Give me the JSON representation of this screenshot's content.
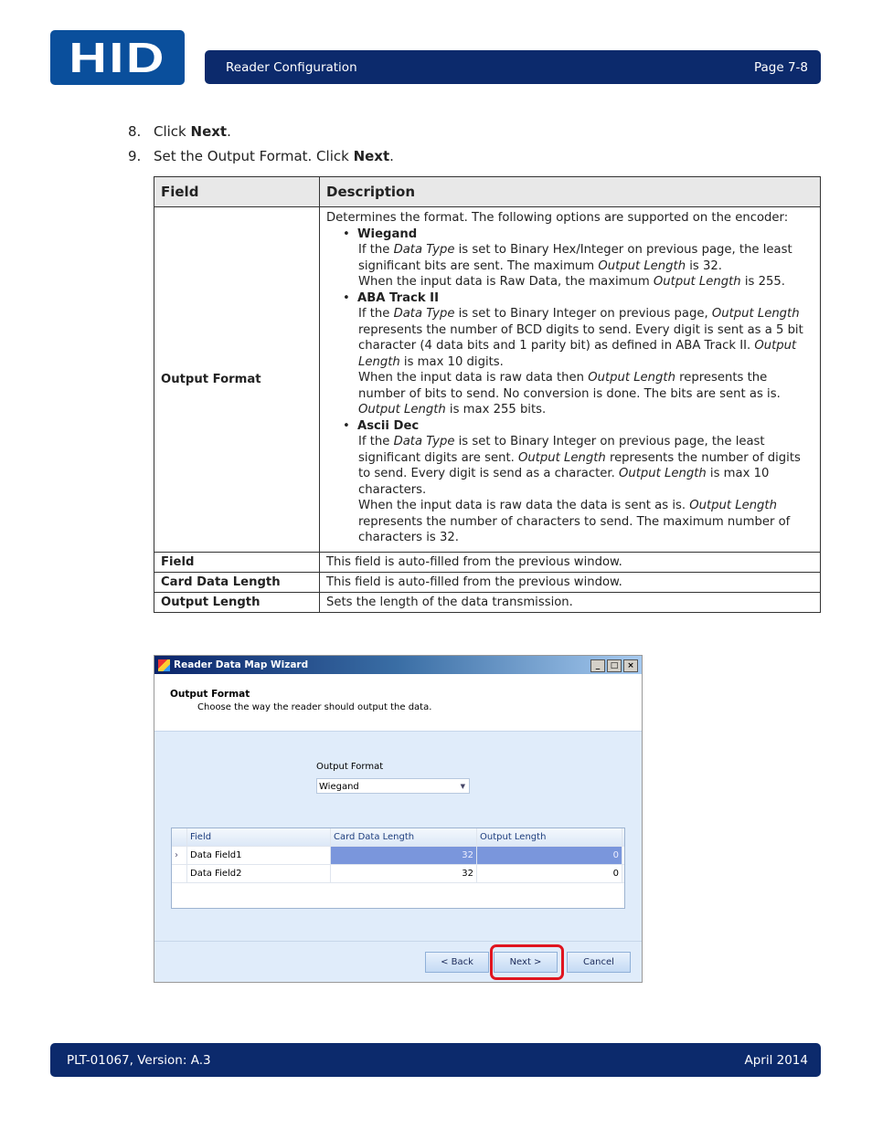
{
  "header": {
    "logo": "HID",
    "title": "Reader Configuration",
    "page": "Page 7-8"
  },
  "steps": [
    {
      "num": "8.",
      "pre": "Click ",
      "bold": "Next",
      "post": "."
    },
    {
      "num": "9.",
      "pre": "Set the Output Format. Click ",
      "bold": "Next",
      "post": "."
    }
  ],
  "table": {
    "headers": [
      "Field",
      "Description"
    ],
    "output_format": {
      "field": "Output Format",
      "paragraphs": [
        {
          "type": "text",
          "segs": [
            {
              "t": "Determines the format. The following options are supported on the encoder:"
            }
          ]
        },
        {
          "type": "bullet",
          "segs": [
            {
              "t": "Wiegand"
            }
          ]
        },
        {
          "type": "ind",
          "segs": [
            {
              "t": "If the "
            },
            {
              "t": "Data Type",
              "i": true
            },
            {
              "t": " is set to Binary Hex/Integer on previous page, the least significant bits are sent. The maximum "
            },
            {
              "t": "Output Length",
              "i": true
            },
            {
              "t": " is 32."
            }
          ]
        },
        {
          "type": "ind",
          "segs": [
            {
              "t": "When the input data is Raw Data, the maximum "
            },
            {
              "t": "Output Length",
              "i": true
            },
            {
              "t": " is 255."
            }
          ]
        },
        {
          "type": "bullet",
          "segs": [
            {
              "t": "ABA Track II"
            }
          ]
        },
        {
          "type": "ind",
          "segs": [
            {
              "t": "If the "
            },
            {
              "t": "Data Type",
              "i": true
            },
            {
              "t": " is set to Binary Integer on previous page, "
            },
            {
              "t": "Output Length",
              "i": true
            },
            {
              "t": " represents the number of BCD digits to send. Every digit is sent as a 5 bit character (4 data bits and 1 parity bit) as defined in ABA Track II. "
            },
            {
              "t": "Output Length",
              "i": true
            },
            {
              "t": " is max 10 digits."
            }
          ]
        },
        {
          "type": "ind",
          "segs": [
            {
              "t": "When the input data is raw data then "
            },
            {
              "t": "Output Length",
              "i": true
            },
            {
              "t": " represents the number of bits to send. No conversion is done. The bits are sent as is. "
            },
            {
              "t": "Output Length",
              "i": true
            },
            {
              "t": " is max 255 bits."
            }
          ]
        },
        {
          "type": "bullet",
          "segs": [
            {
              "t": "Ascii Dec"
            }
          ]
        },
        {
          "type": "ind",
          "segs": [
            {
              "t": "If the "
            },
            {
              "t": "Data Type",
              "i": true
            },
            {
              "t": " is set to Binary Integer on previous page, the least significant digits are sent. "
            },
            {
              "t": "Output Length",
              "i": true
            },
            {
              "t": " represents the number of digits to send. Every digit is send as a character. "
            },
            {
              "t": "Output Length",
              "i": true
            },
            {
              "t": " is max 10 characters."
            }
          ]
        },
        {
          "type": "ind",
          "segs": [
            {
              "t": "When the input data is raw data the data is sent as is. "
            },
            {
              "t": "Output Length",
              "i": true
            },
            {
              "t": " represents the number of characters to send. The maximum number of characters is 32."
            }
          ]
        }
      ]
    },
    "rows": [
      {
        "field": "Field",
        "desc": "This field is auto-filled from the previous window."
      },
      {
        "field": "Card Data Length",
        "desc": "This field is auto-filled from the previous window."
      },
      {
        "field": "Output Length",
        "desc": "Sets the length of the data transmission."
      }
    ]
  },
  "dialog": {
    "title": "Reader Data Map Wizard",
    "heading": "Output Format",
    "subheading": "Choose the way the reader should output the data.",
    "format_label": "Output Format",
    "format_value": "Wiegand",
    "grid_headers": [
      "Field",
      "Card Data Length",
      "Output Length"
    ],
    "grid_rows": [
      {
        "field": "Data Field1",
        "card": "32",
        "out": "0"
      },
      {
        "field": "Data Field2",
        "card": "32",
        "out": "0"
      }
    ],
    "back": "< Back",
    "next": "Next >",
    "cancel": "Cancel"
  },
  "footer": {
    "doc": "PLT-01067, Version: A.3",
    "date": "April 2014"
  }
}
